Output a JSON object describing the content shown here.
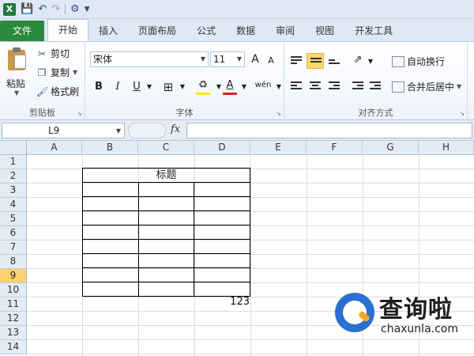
{
  "quick_access": {
    "app_icon": "X",
    "icons": [
      "save-icon",
      "undo-icon",
      "redo-icon",
      "customize-icon"
    ]
  },
  "tabs": [
    "文件",
    "开始",
    "插入",
    "页面布局",
    "公式",
    "数据",
    "审阅",
    "视图",
    "开发工具"
  ],
  "active_tab": "开始",
  "clipboard": {
    "paste": "粘贴",
    "cut": "剪切",
    "copy": "复制",
    "format_painter": "格式刷",
    "group_label": "剪贴板"
  },
  "font": {
    "name": "宋体",
    "size": "11",
    "bold": "B",
    "italic": "I",
    "underline": "U",
    "grow": "A",
    "shrink": "A",
    "wen": "wén",
    "group_label": "字体"
  },
  "alignment": {
    "wrap_text": "自动换行",
    "merge_center": "合并后居中",
    "group_label": "对齐方式"
  },
  "formula_bar": {
    "name_box": "L9",
    "fx": "fx",
    "formula": ""
  },
  "columns": [
    "A",
    "B",
    "C",
    "D",
    "E",
    "F",
    "G",
    "H"
  ],
  "rows": [
    "1",
    "2",
    "3",
    "4",
    "5",
    "6",
    "7",
    "8",
    "9",
    "10",
    "11",
    "12",
    "13",
    "14"
  ],
  "active_row": "9",
  "cells": {
    "title": "标题",
    "d11_value": "123"
  },
  "watermark": {
    "title": "查询啦",
    "url": "chaxunla.com"
  },
  "colors": {
    "file_tab": "#2a8a3e",
    "active_row_header": "#f9d26f",
    "logo_blue": "#2b6fd0"
  }
}
